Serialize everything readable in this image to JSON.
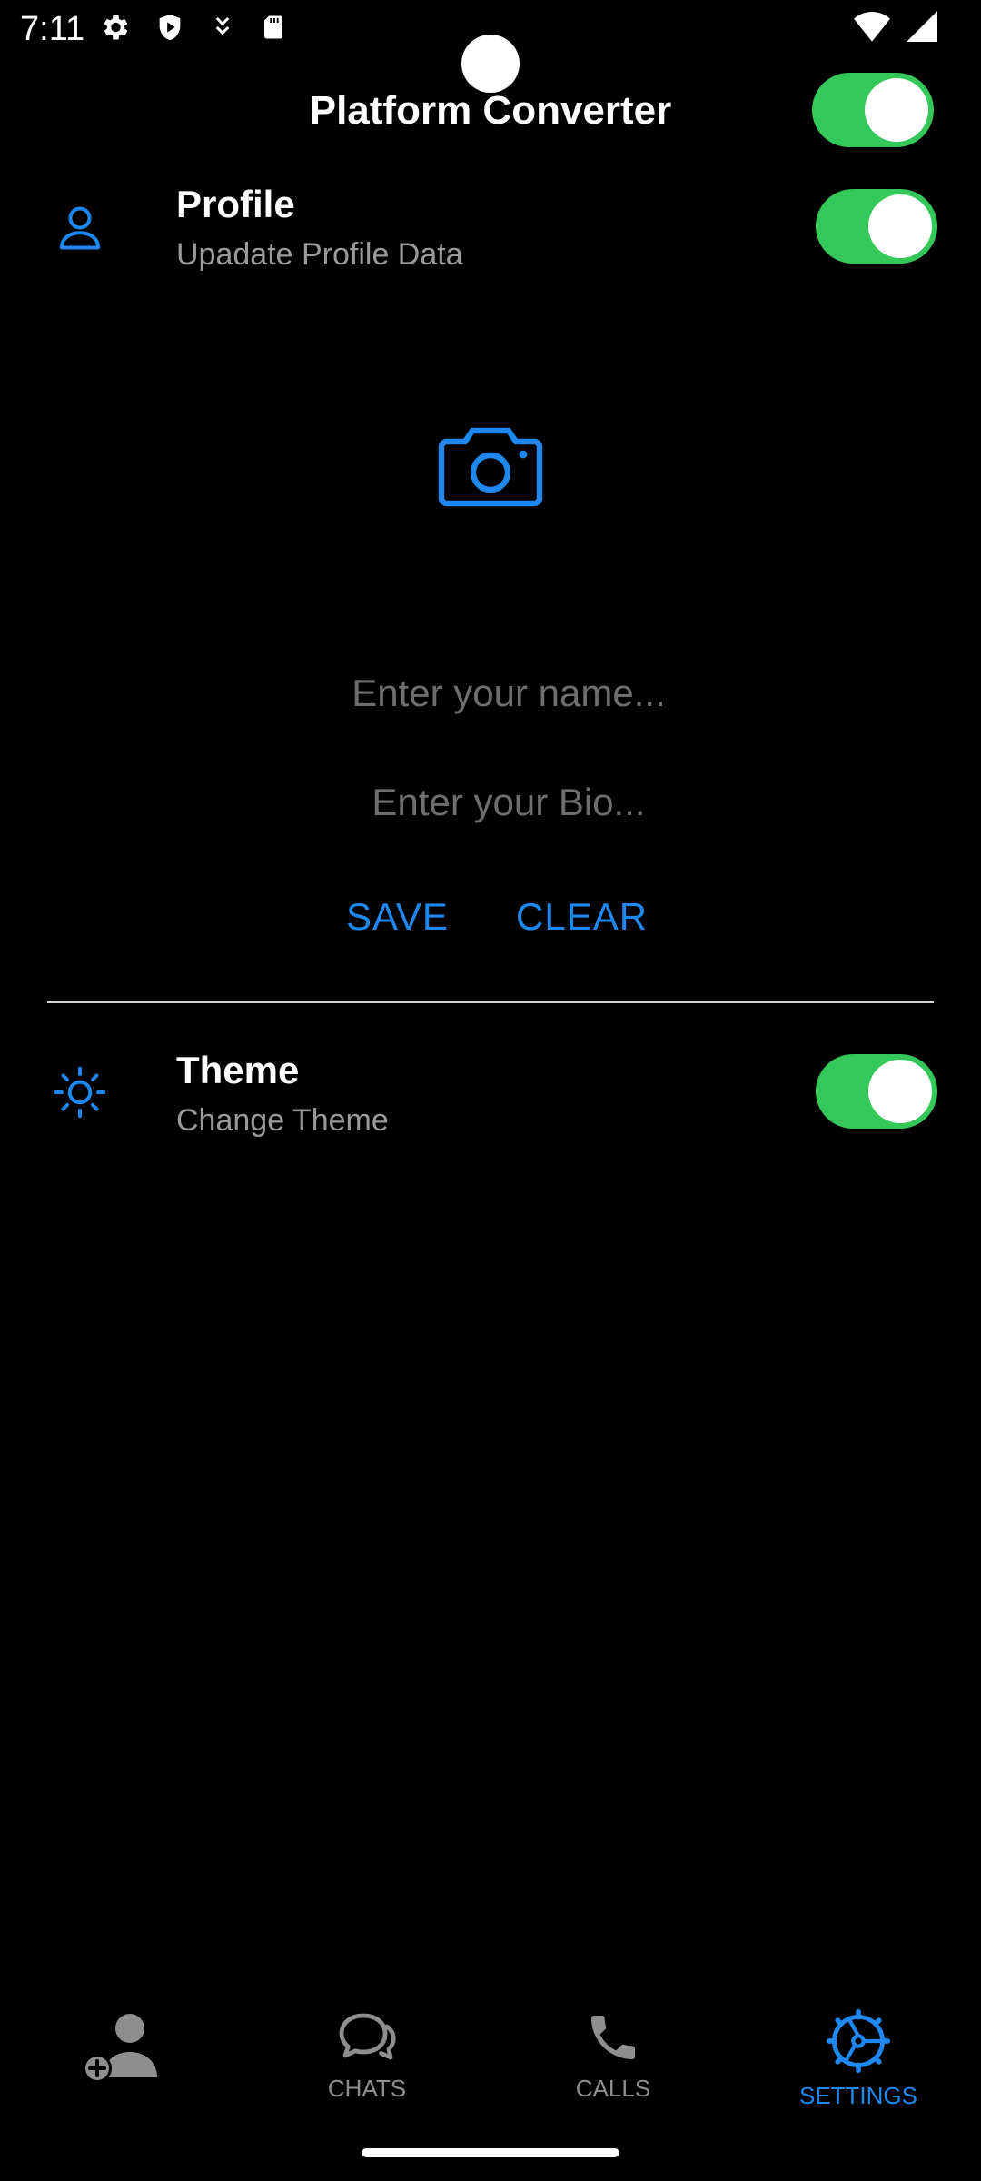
{
  "status_bar": {
    "time": "7:11",
    "left_icons": [
      "settings-icon",
      "shield-icon",
      "download-icon",
      "sd-card-icon"
    ],
    "right_icons": [
      "wifi-icon",
      "signal-icon"
    ]
  },
  "header": {
    "title": "Platform Converter",
    "toggle_on": true
  },
  "profile": {
    "title": "Profile",
    "subtitle": "Upadate Profile Data",
    "icon": "person-icon",
    "toggle_on": true,
    "camera_icon": "camera-icon",
    "name_placeholder": "Enter your name...",
    "bio_placeholder": "Enter your Bio...",
    "save_label": "SAVE",
    "clear_label": "CLEAR"
  },
  "theme": {
    "title": "Theme",
    "subtitle": "Change Theme",
    "icon": "sun-icon",
    "toggle_on": true
  },
  "nav": {
    "items": [
      {
        "label": "",
        "icon": "add-contact-icon"
      },
      {
        "label": "CHATS",
        "icon": "chat-icon"
      },
      {
        "label": "CALLS",
        "icon": "phone-icon"
      },
      {
        "label": "SETTINGS",
        "icon": "settings-gear-icon"
      }
    ],
    "active_index": 3
  },
  "colors": {
    "accent": "#1e88f0",
    "toggle_on": "#34c759",
    "background": "#000000",
    "muted": "#8e8e8e"
  }
}
